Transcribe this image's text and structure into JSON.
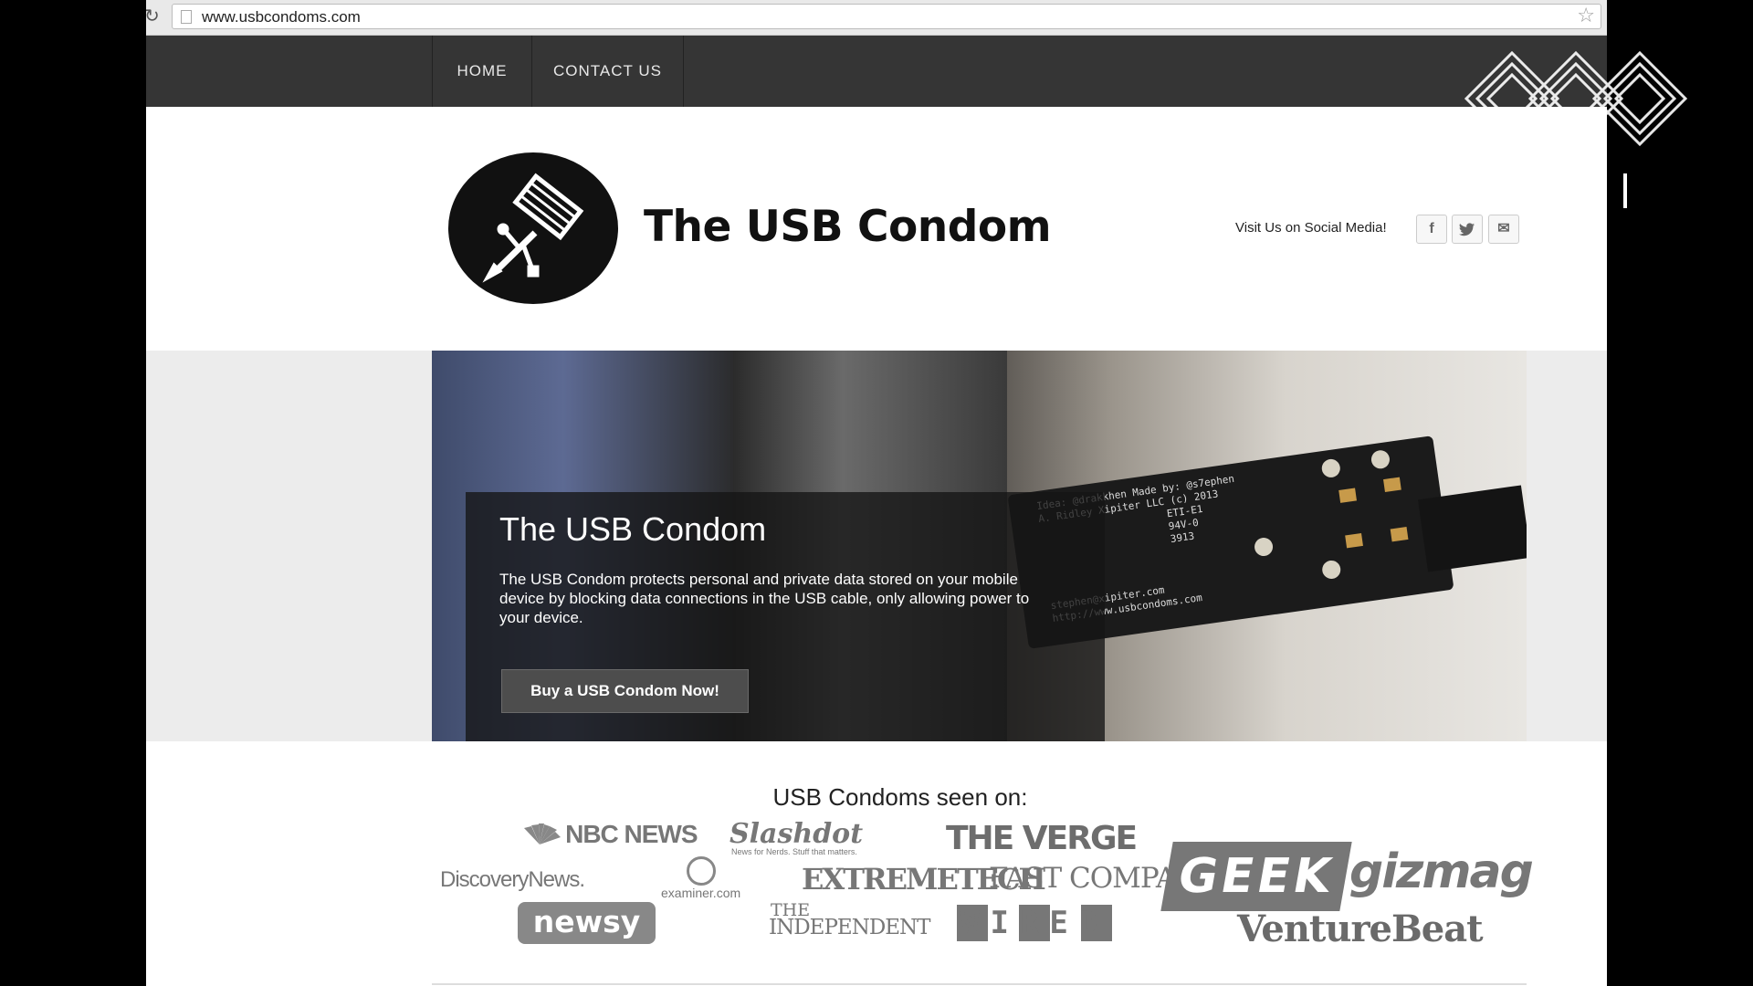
{
  "browser": {
    "url": "www.usbcondoms.com"
  },
  "nav": {
    "items": [
      "HOME",
      "CONTACT US"
    ]
  },
  "header": {
    "site_title": "The USB Condom",
    "social_label": "Visit Us on Social Media!",
    "social": {
      "facebook": "f",
      "twitter": "t",
      "email": "✉"
    }
  },
  "hero": {
    "title": "The USB Condom",
    "description": "The USB Condom protects personal and private data stored on your mobile device by blocking data connections in the USB cable, only allowing power to your device.",
    "button_label": "Buy a USB Condom Now!",
    "pcb_text": [
      "Idea: @drakkhen Made by: @s7ephen",
      "A. Ridley Xipiter LLC (c) 2013",
      "ETI-E1",
      "94V-0",
      "3913",
      "stephen@xipiter.com",
      "http://www.usbcondoms.com"
    ]
  },
  "press": {
    "title": "USB Condoms seen on:",
    "logos": {
      "nbc": "NBC NEWS",
      "slashdot": "Slashdot",
      "slashdot_tagline": "News for Nerds. Stuff that matters.",
      "verge": "THE VERGE",
      "discovery": "DiscoveryNews.",
      "examiner": "examiner.com",
      "extremetech": "EXTREMETECH",
      "fastcompany": "FAST COMPANY",
      "geek": "GEEK",
      "gizmag": "gizmag",
      "newsy": "newsy",
      "independent_the": "THE",
      "independent": "INDEPENDENT",
      "wired": "WIRED",
      "venturebeat": "VentureBeat"
    }
  },
  "colors": {
    "nav_bg": "#353535",
    "page_bg": "#ffffff",
    "band_bg": "#ececec",
    "logo_gray": "#777777"
  }
}
